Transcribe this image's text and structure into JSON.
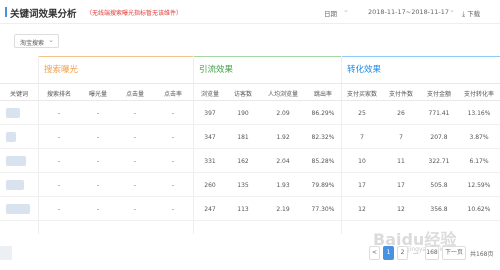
{
  "header": {
    "title": "关键词效果分析",
    "subtitle": "（无线端搜索曝光指标暂无该维件）",
    "date_label": "日期",
    "date_range": "2018-11-17~2018-11-17",
    "download": "下载",
    "accent": "#4a90e2"
  },
  "filter": {
    "selected": "淘宝搜索"
  },
  "groups": [
    {
      "label": "搜索曝光",
      "color": "#f0a050"
    },
    {
      "label": "引流效果",
      "color": "#43a047"
    },
    {
      "label": "转化效果",
      "color": "#1e88e5"
    }
  ],
  "columns": [
    "关键词",
    "搜索排名",
    "曝光量",
    "点击量",
    "点击率",
    "浏览量",
    "访客数",
    "人均浏览量",
    "跳出率",
    "支付买家数",
    "支付件数",
    "支付金额",
    "支付转化率"
  ],
  "rows": [
    [
      "-",
      "-",
      "-",
      "-",
      "397",
      "190",
      "2.09",
      "86.29%",
      "25",
      "26",
      "771.41",
      "13.16%"
    ],
    [
      "-",
      "-",
      "-",
      "-",
      "347",
      "181",
      "1.92",
      "82.32%",
      "7",
      "7",
      "207.8",
      "3.87%"
    ],
    [
      "-",
      "-",
      "-",
      "-",
      "331",
      "162",
      "2.04",
      "85.28%",
      "10",
      "11",
      "322.71",
      "6.17%"
    ],
    [
      "-",
      "-",
      "-",
      "-",
      "260",
      "135",
      "1.93",
      "79.89%",
      "17",
      "17",
      "505.8",
      "12.59%"
    ],
    [
      "-",
      "-",
      "-",
      "-",
      "247",
      "113",
      "2.19",
      "77.30%",
      "12",
      "12",
      "356.8",
      "10.62%"
    ]
  ],
  "pagination": {
    "prev": "<",
    "pages": [
      "1",
      "2",
      "...",
      "168"
    ],
    "next": "下一页",
    "total": "共168页"
  },
  "watermark": {
    "main": "Baidu经验",
    "sub": "jingyan.baidu.com"
  }
}
